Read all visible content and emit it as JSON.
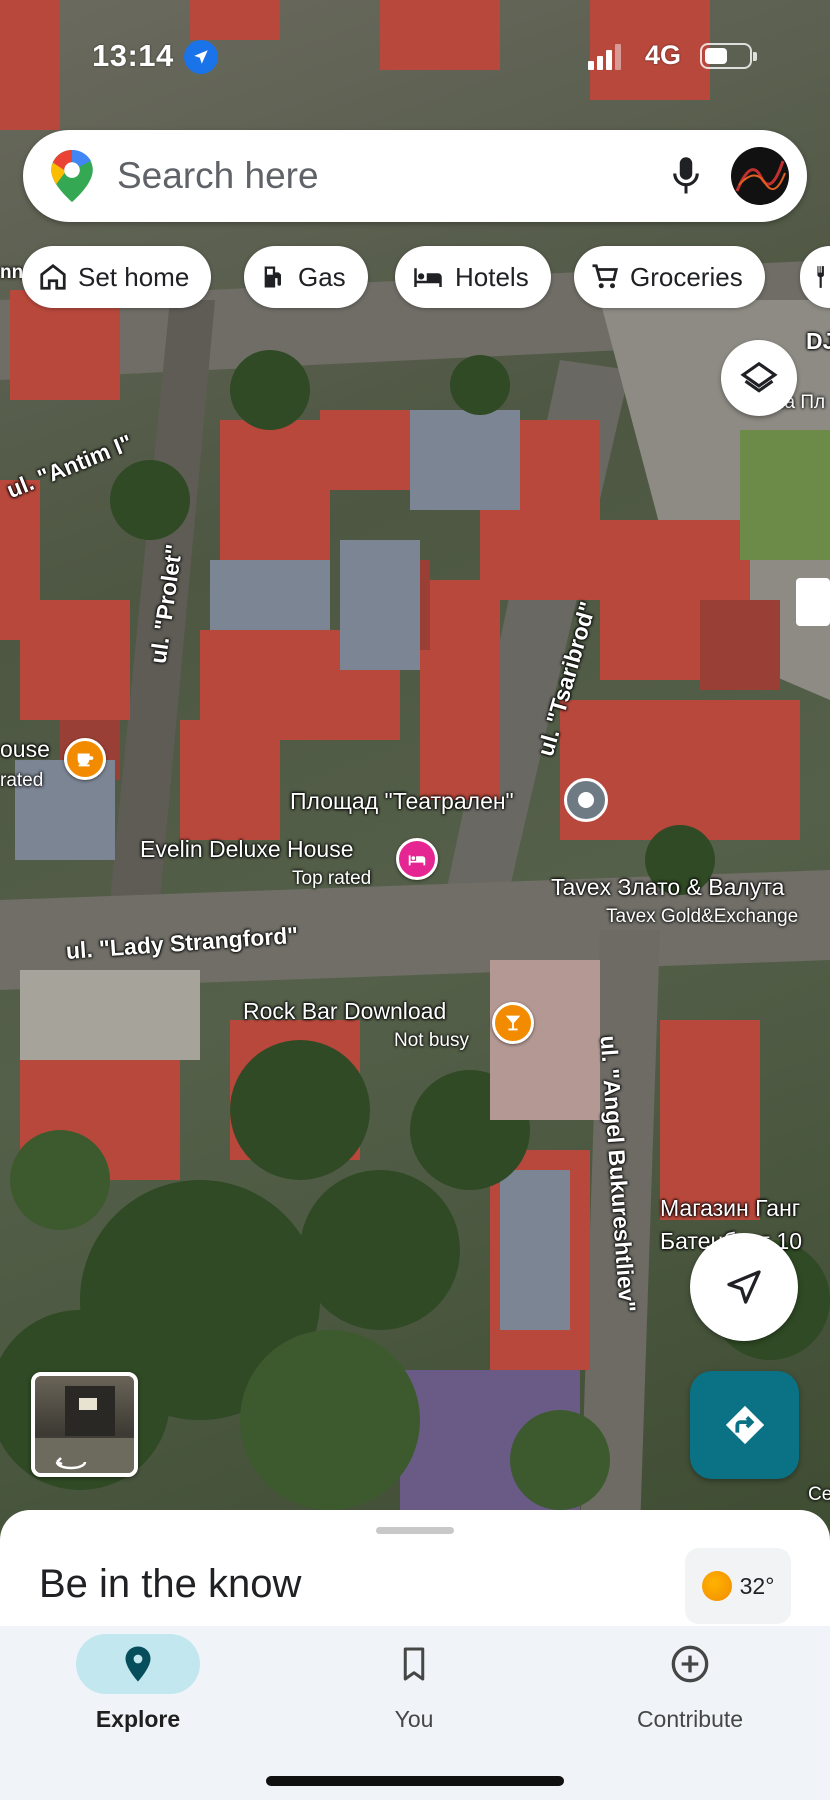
{
  "status_bar": {
    "time": "13:14",
    "network": "4G"
  },
  "search": {
    "placeholder": "Search here"
  },
  "chips": [
    {
      "label": "Set home",
      "icon": "home-icon"
    },
    {
      "label": "Gas",
      "icon": "gas-station-icon"
    },
    {
      "label": "Hotels",
      "icon": "bed-icon"
    },
    {
      "label": "Groceries",
      "icon": "cart-icon"
    }
  ],
  "map": {
    "streets": [
      "ul. \"Antim I\"",
      "ul. \"Prolet\"",
      "ul. \"Tsaribrod\"",
      "ul. \"Lady Strangford\"",
      "ul. \"Angel Bukureshtliev\""
    ],
    "places": {
      "square": "Площад \"Театрален\"",
      "hotel": {
        "name": "Evelin Deluxe House",
        "sub": "Top rated"
      },
      "bar": {
        "name": "Rock Bar Download",
        "sub": "Not busy"
      },
      "exchange": {
        "name": "Tavex Злато & Валута",
        "sub": "Tavex Gold&Exchange"
      },
      "shop": {
        "line1": "Магазин Ганг",
        "line2": "Батенберг 10"
      },
      "cafe_left": {
        "line1": "ouse",
        "line2": "rated"
      },
      "edge_right": "DJ",
      "edge_right_2": "на Пл",
      "edge_right_3": "Ce",
      "edge_left": "nn"
    }
  },
  "sheet": {
    "title": "Be in the know",
    "temperature": "32°"
  },
  "bottom_nav": [
    {
      "label": "Explore",
      "active": true
    },
    {
      "label": "You",
      "active": false
    },
    {
      "label": "Contribute",
      "active": false
    }
  ],
  "colors": {
    "accent": "#0b7285",
    "nav_active_bg": "#c2e7ef",
    "hotel_pin": "#e52592",
    "food_pin": "#f28b00"
  }
}
